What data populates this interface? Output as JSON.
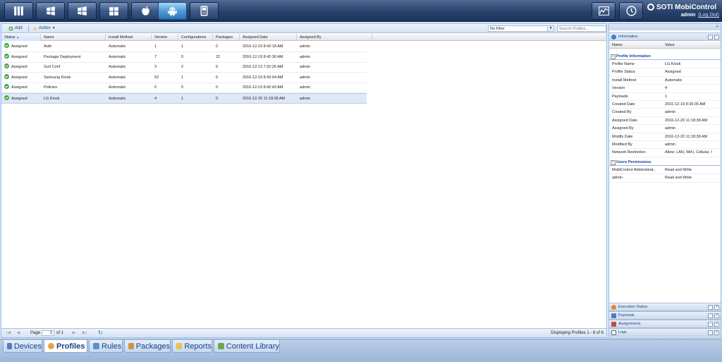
{
  "header": {
    "brand": "SOTI MobiControl",
    "user": "admin",
    "logout": "(Log Out)"
  },
  "toolbar": {
    "add_label": "Add",
    "action_label": "Action",
    "filter_value": "No Filter",
    "search_placeholder": "Search Profiles..."
  },
  "grid": {
    "columns": [
      "Status",
      "Name",
      "Install Method",
      "Version",
      "Configurations",
      "Packages",
      "Assigned Date",
      "Assigned By"
    ],
    "rows": [
      {
        "status": "Assigned",
        "name": "Auth",
        "install": "Automatic",
        "version": "1",
        "configs": "1",
        "packages": "0",
        "date": "2016-12-19 8:42:18 AM",
        "by": "admin"
      },
      {
        "status": "Assigned",
        "name": "Package Deployment",
        "install": "Automatic",
        "version": "7",
        "configs": "0",
        "packages": "22",
        "date": "2016-12-19 8:42:30 AM",
        "by": "admin"
      },
      {
        "status": "Assigned",
        "name": "Surf Conf",
        "install": "Automatic",
        "version": "3",
        "configs": "2",
        "packages": "0",
        "date": "2016-12-13 7:32:26 AM",
        "by": "admin"
      },
      {
        "status": "Assigned",
        "name": "Samsung Kiosk",
        "install": "Automatic",
        "version": "52",
        "configs": "1",
        "packages": "0",
        "date": "2016-12-19 8:43:04 AM",
        "by": "admin"
      },
      {
        "status": "Assigned",
        "name": "Policies",
        "install": "Automatic",
        "version": "5",
        "configs": "5",
        "packages": "0",
        "date": "2016-12-19 8:42:43 AM",
        "by": "admin"
      },
      {
        "status": "Assigned",
        "name": "LG Kiosk",
        "install": "Automatic",
        "version": "4",
        "configs": "1",
        "packages": "0",
        "date": "2016-12-20 11:18:38 AM",
        "by": "admin"
      }
    ]
  },
  "pager": {
    "page_label": "Page",
    "page_value": "1",
    "of_label": "of 1",
    "display": "Displaying Profiles 1 - 6 of 6"
  },
  "info_panel": {
    "title": "Information",
    "col_name": "Name",
    "col_value": "Value",
    "profile_group": "Profile Information",
    "profile_rows": [
      {
        "k": "Profile Name",
        "v": "LG Kiosk"
      },
      {
        "k": "Profile Status",
        "v": "Assigned"
      },
      {
        "k": "Install Method",
        "v": "Automatic"
      },
      {
        "k": "Version",
        "v": "4"
      },
      {
        "k": "Payloads",
        "v": "1"
      },
      {
        "k": "Created Date",
        "v": "2016-12-19 8:39:35 AM"
      },
      {
        "k": "Created By",
        "v": "admin"
      },
      {
        "k": "Assigned Date",
        "v": "2016-12-20 11:18:38 AM"
      },
      {
        "k": "Assigned By",
        "v": "admin"
      },
      {
        "k": "Modify Date",
        "v": "2016-12-20 11:18:38 AM"
      },
      {
        "k": "Modified By",
        "v": "admin"
      },
      {
        "k": "Network Restriction",
        "v": "Allow: LAN, WiFi, Cellular, I"
      }
    ],
    "perm_group": "Users Permissions",
    "perm_rows": [
      {
        "k": "MobiControl Administrat...",
        "v": "Read and Write"
      },
      {
        "k": "admin",
        "v": "Read and Write"
      }
    ]
  },
  "side_panels": [
    "Execution Status",
    "Payloads",
    "Assignments",
    "Logs"
  ],
  "bottom_tabs": [
    "Devices",
    "Profiles",
    "Rules",
    "Packages",
    "Reports",
    "Content Library"
  ]
}
